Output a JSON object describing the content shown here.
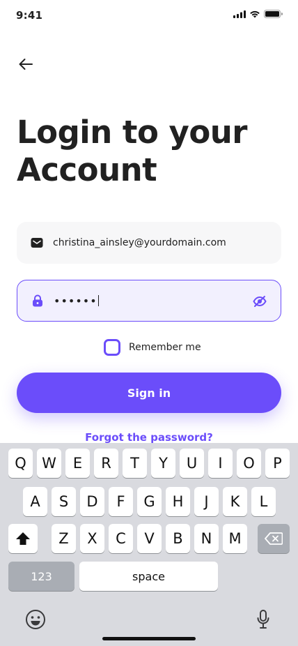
{
  "status_bar": {
    "time": "9:41",
    "icons": [
      "signal-icon",
      "wifi-icon",
      "battery-icon"
    ]
  },
  "header": {
    "back_icon": "arrow-left-icon"
  },
  "title": {
    "line1": "Login to your",
    "line2": "Account"
  },
  "email_field": {
    "icon": "mail-icon",
    "value": "christina_ainsley@yourdomain.com"
  },
  "password_field": {
    "icon": "lock-icon",
    "value": "••••••",
    "toggle_icon": "eye-off-icon"
  },
  "remember": {
    "label": "Remember me",
    "checked": false
  },
  "signin": {
    "label": "Sign in"
  },
  "forgot": {
    "label": "Forgot the password?"
  },
  "keyboard": {
    "row1": [
      "Q",
      "W",
      "E",
      "R",
      "T",
      "Y",
      "U",
      "I",
      "O",
      "P"
    ],
    "row2": [
      "A",
      "S",
      "D",
      "F",
      "G",
      "H",
      "J",
      "K",
      "L"
    ],
    "row3": [
      "Z",
      "X",
      "C",
      "V",
      "B",
      "N",
      "M"
    ],
    "numbers_label": "123",
    "space_label": "space",
    "icons": [
      "shift-icon",
      "backspace-icon",
      "emoji-icon",
      "microphone-icon"
    ]
  },
  "colors": {
    "accent": "#6b4dfa",
    "text": "#212121",
    "field_bg": "#f7f7f8",
    "field_active_bg": "#f2f0fe",
    "keyboard_bg": "#d9dadf"
  }
}
